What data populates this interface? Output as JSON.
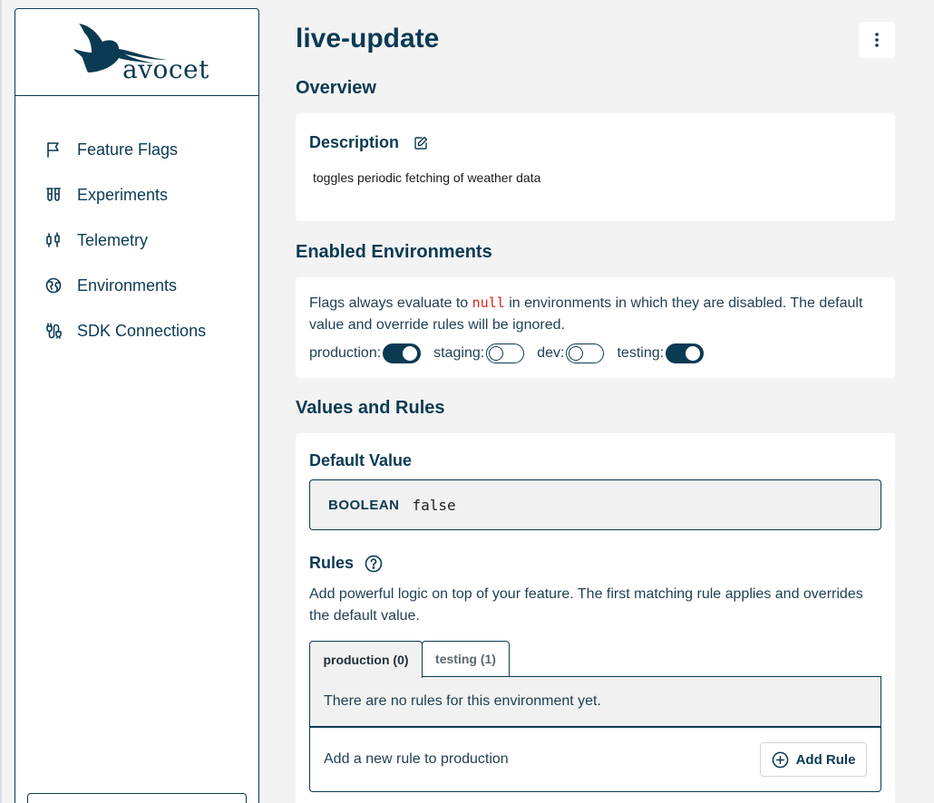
{
  "sidebar": {
    "logo_text": "avocet",
    "items": [
      {
        "label": "Feature Flags",
        "icon": "flag-icon"
      },
      {
        "label": "Experiments",
        "icon": "test-tubes-icon"
      },
      {
        "label": "Telemetry",
        "icon": "candlestick-icon"
      },
      {
        "label": "Environments",
        "icon": "globe-icon"
      },
      {
        "label": "SDK Connections",
        "icon": "cable-icon"
      }
    ]
  },
  "page": {
    "title": "live-update",
    "menu_icon": "kebab-menu-icon"
  },
  "overview": {
    "section_title": "Overview",
    "description_heading": "Description",
    "description_text": "toggles periodic fetching of weather data"
  },
  "environments": {
    "section_title": "Enabled Environments",
    "text_before": "Flags always evaluate to ",
    "code": "null",
    "text_after": " in environments in which they are disabled. The default value and override rules will be ignored.",
    "toggles": [
      {
        "label": "production:",
        "enabled": true
      },
      {
        "label": "staging:",
        "enabled": false
      },
      {
        "label": "dev:",
        "enabled": false
      },
      {
        "label": "testing:",
        "enabled": true
      }
    ]
  },
  "values_rules": {
    "section_title": "Values and Rules",
    "default_heading": "Default Value",
    "type_label": "BOOLEAN",
    "default_value": "false",
    "rules_heading": "Rules",
    "rules_description": "Add powerful logic on top of your feature. The first matching rule applies and overrides the default value.",
    "tabs": [
      {
        "label": "production (0)",
        "active": true
      },
      {
        "label": "testing (1)",
        "active": false
      }
    ],
    "no_rules_text": "There are no rules for this environment yet.",
    "add_rule_text": "Add a new rule to production",
    "add_rule_button": "Add Rule"
  },
  "colors": {
    "brand": "#0b3a53",
    "background": "#f3f3f3",
    "code_null": "#e0201b"
  }
}
